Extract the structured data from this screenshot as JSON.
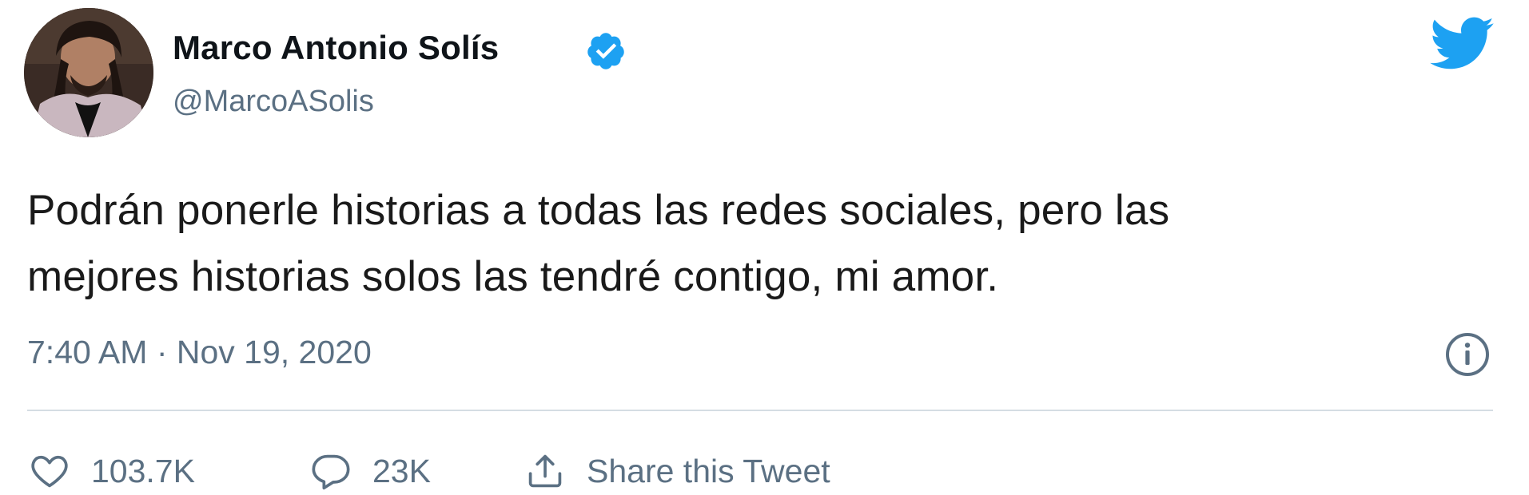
{
  "author": {
    "name": "Marco Antonio Solís",
    "handle": "@MarcoASolis",
    "verified": true
  },
  "tweet": {
    "text_line_1": "Podrán ponerle historias a todas las redes sociales, pero las",
    "text_line_2": "mejores historias solos las tendré contigo, mi amor.",
    "timestamp": "7:40 AM · Nov 19, 2020"
  },
  "actions": {
    "like_count": "103.7K",
    "reply_count": "23K",
    "share_label": "Share this Tweet"
  },
  "icons": {
    "brand": "twitter-bird-icon",
    "verified": "verified-badge-icon",
    "info": "info-icon",
    "like": "heart-icon",
    "reply": "reply-bubble-icon",
    "share": "share-upload-icon"
  },
  "colors": {
    "brand_blue": "#1da1f2",
    "secondary_text": "#5b7083",
    "primary_text": "#0f1419",
    "divider": "#d5dde3"
  }
}
